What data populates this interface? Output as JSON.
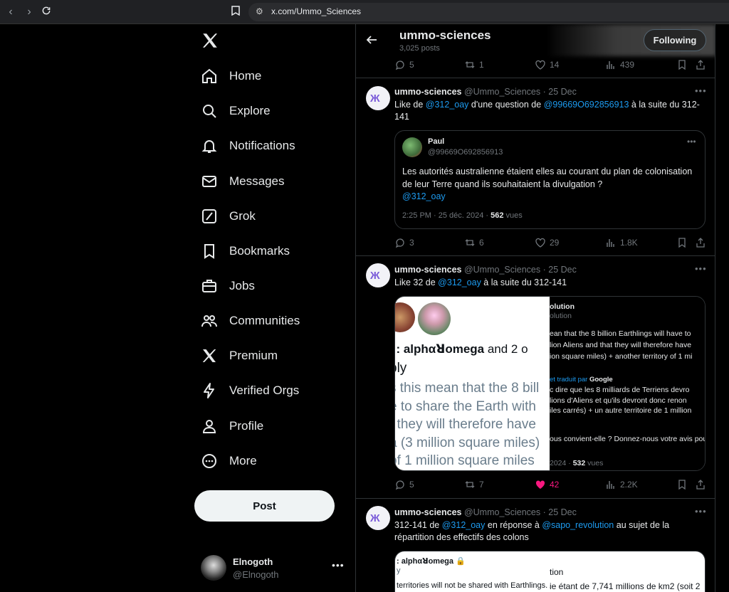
{
  "browser": {
    "url": "x.com/Ummo_Sciences"
  },
  "nav": {
    "items": [
      {
        "label": "Home"
      },
      {
        "label": "Explore"
      },
      {
        "label": "Notifications"
      },
      {
        "label": "Messages"
      },
      {
        "label": "Grok"
      },
      {
        "label": "Bookmarks"
      },
      {
        "label": "Jobs"
      },
      {
        "label": "Communities"
      },
      {
        "label": "Premium"
      },
      {
        "label": "Verified Orgs"
      },
      {
        "label": "Profile"
      },
      {
        "label": "More"
      }
    ],
    "post_label": "Post"
  },
  "account": {
    "name": "Elnogoth",
    "handle": "@Elnogoth"
  },
  "header": {
    "name": "ummo-sciences",
    "posts_count": "3,025 posts",
    "follow_label": "Following"
  },
  "tweet0": {
    "replies": "5",
    "reposts": "1",
    "likes": "14",
    "views": "439"
  },
  "tweet1": {
    "name": "ummo-sciences",
    "handle_date": "@Ummo_Sciences · 25 Dec",
    "text_a": "Like de ",
    "mention_a": "@312_oay",
    "text_b": " d'une question de ",
    "mention_b": "@99669O692856913",
    "text_c": " à la suite du 312-141",
    "quote": {
      "name": "Paul",
      "handle": "@99669O692856913",
      "text": "Les autorités australienne étaient elles au courant du plan de colonisation de leur Terre quand ils souhaitaient la divulgation ?",
      "mention": "@312_oay",
      "meta": "2:25 PM · 25 déc. 2024 · ",
      "views": "562",
      "views_suffix": " vues"
    },
    "replies": "3",
    "reposts": "6",
    "likes": "29",
    "views": "1.8K"
  },
  "tweet2": {
    "name": "ummo-sciences",
    "handle_date": "@Ummo_Sciences · 25 Dec",
    "text_a": "Like 32 de ",
    "mention_a": "@312_oay",
    "text_b": " à la suite du 312-141",
    "media_left": {
      "title_a": "l : alphαꓤomega",
      "title_b": " and 2 o",
      "line1": "ply",
      "line2": "s this mean that the 8 bill",
      "line3": "e to share the Earth with",
      "line4": "t they will therefore have",
      "line5": "a (3 million square miles)",
      "line6": "of 1 million square miles"
    },
    "media_right": {
      "r1": "olution",
      "r2": "olution",
      "r3": "ean that the 8 billion Earthlings will have to",
      "r4": "lion Aliens and that they will therefore have",
      "r5": "ion square miles) + another territory of 1 mi",
      "r6": "et traduit par ",
      "r6b": "Google",
      "r7": "c dire que les 8 milliards de Terriens devro",
      "r8": "lions d'Aliens et qu'ils devront donc renon",
      "r9": "iles carrés) + un autre territoire de 1 million",
      "r10": "ous convient-elle ? Donnez-nous votre avis pour qu",
      "r11": "2024 · ",
      "r11b": "532",
      "r11c": " vues"
    },
    "replies": "5",
    "reposts": "7",
    "likes": "42",
    "views": "2.2K"
  },
  "tweet3": {
    "name": "ummo-sciences",
    "handle_date": "@Ummo_Sciences · 25 Dec",
    "text_a": "312-141 de ",
    "mention_a": "@312_oay",
    "text_b": " en réponse à ",
    "mention_b": "@sapo_revolution",
    "text_c": " au sujet de la répartition des effectifs des colons",
    "media_left": {
      "a": ": alphαꓤomega 🔒",
      "b": "y",
      "c": "territories will not be shared with Earthlings. A"
    },
    "media_right": {
      "a": "tion",
      "b": "ie étant de 7,741 millions de km2 (soit 2"
    }
  },
  "colors": {
    "accent": "#1d9bf0",
    "like_active": "#f91880",
    "muted": "#71767b",
    "border": "#2f3336"
  }
}
